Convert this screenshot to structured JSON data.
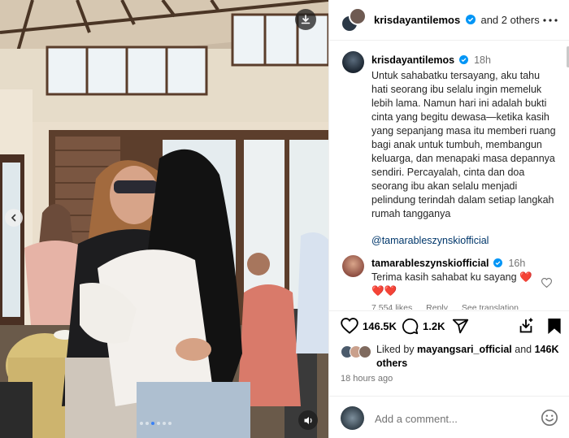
{
  "header": {
    "username": "krisdayantilemos",
    "and_others": "and 2 others"
  },
  "caption": {
    "username": "krisdayantilemos",
    "time": "18h",
    "text": "Untuk sahabatku tersayang, aku tahu hati seorang ibu selalu ingin memeluk lebih lama. Namun hari ini adalah bukti cinta yang begitu dewasa—ketika kasih yang sepanjang masa itu memberi ruang bagi anak untuk tumbuh, membangun keluarga, dan menapaki masa depannya sendiri. Percayalah, cinta dan doa seorang ibu akan selalu menjadi pelindung terindah dalam setiap langkah rumah tangganya",
    "mention": "@tamarableszynskiofficial"
  },
  "comment1": {
    "username": "tamarableszynskiofficial",
    "time": "16h",
    "text": "Terima kasih sahabat ku sayang ❤️",
    "hearts": "❤️❤️",
    "likes": "7,554 likes",
    "reply": "Reply",
    "see_translation": "See translation"
  },
  "actions": {
    "like_count": "146.5K",
    "comment_count": "1.2K"
  },
  "likes": {
    "prefix": "Liked by",
    "user": "mayangsari_official",
    "middle": "and",
    "count": "146K others"
  },
  "post_time": "18 hours ago",
  "add_comment": {
    "placeholder": "Add a comment..."
  },
  "colors": {
    "verified": "#0095f6",
    "heart": "#e0242e",
    "link": "#00376b",
    "muted": "#737373"
  },
  "icons": [
    "download-icon",
    "chevron-left-icon",
    "mute-icon",
    "more-icon",
    "verified-icon",
    "heart-icon",
    "comment-icon",
    "share-icon",
    "repost-icon",
    "bookmark-icon",
    "emoji-icon"
  ]
}
